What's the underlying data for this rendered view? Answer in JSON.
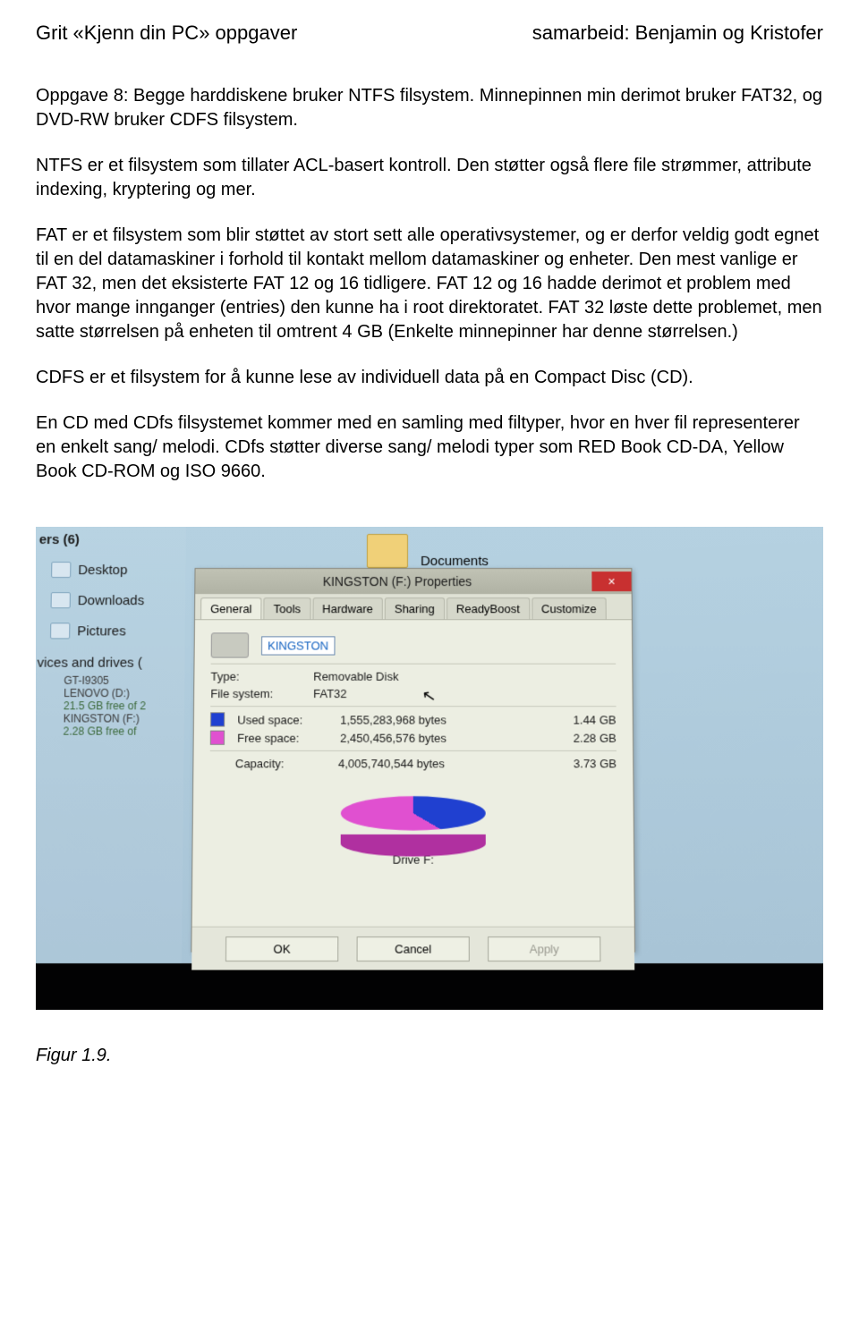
{
  "header": {
    "left": "Grit «Kjenn din PC» oppgaver",
    "right": "samarbeid: Benjamin og Kristofer"
  },
  "paragraphs": {
    "p1": "Oppgave 8: Begge harddiskene bruker NTFS filsystem. Minnepinnen min derimot bruker FAT32, og DVD-RW bruker CDFS filsystem.",
    "p2": "NTFS er et filsystem som tillater ACL-basert kontroll. Den støtter også flere file strømmer, attribute indexing, kryptering og mer.",
    "p3": "FAT er et filsystem som blir støttet av stort sett alle operativsystemer, og er derfor veldig godt egnet til en del datamaskiner i forhold til kontakt mellom datamaskiner og enheter. Den mest vanlige er FAT 32, men det eksisterte FAT 12 og 16 tidligere. FAT 12 og 16 hadde derimot et problem med hvor mange innganger (entries) den kunne ha i root direktoratet. FAT 32 løste dette problemet, men satte størrelsen på enheten til omtrent 4 GB (Enkelte minnepinner har denne størrelsen.)",
    "p4": "CDFS er et filsystem for å kunne lese av individuell data på en Compact Disc (CD).",
    "p5": "En CD med CDfs filsystemet kommer med en samling med filtyper, hvor en hver fil representerer en enkelt sang/ melodi. CDfs støtter diverse sang/ melodi typer som RED Book CD-DA, Yellow Book CD-ROM og ISO 9660."
  },
  "caption": "Figur 1.9.",
  "explorer": {
    "folders_header": "ers (6)",
    "items": {
      "desktop": "Desktop",
      "downloads": "Downloads",
      "pictures": "Pictures"
    },
    "devices_header": "vices and drives (",
    "drives": {
      "gt": "GT-I9305",
      "lenovo": "LENOVO (D:)",
      "lenovo_free": "21.5 GB free of 2",
      "kingston": "KINGSTON (F:)",
      "kingston_free": "2.28 GB free of"
    },
    "documents_label": "Documents"
  },
  "dialog": {
    "title": "KINGSTON (F:) Properties",
    "close": "×",
    "tabs": {
      "general": "General",
      "tools": "Tools",
      "hardware": "Hardware",
      "sharing": "Sharing",
      "readyboost": "ReadyBoost",
      "customize": "Customize"
    },
    "name_value": "KINGSTON",
    "type_label": "Type:",
    "type_value": "Removable Disk",
    "fs_label": "File system:",
    "fs_value": "FAT32",
    "used_label": "Used space:",
    "used_bytes": "1,555,283,968 bytes",
    "used_gb": "1.44 GB",
    "free_label": "Free space:",
    "free_bytes": "2,450,456,576 bytes",
    "free_gb": "2.28 GB",
    "capacity_label": "Capacity:",
    "capacity_bytes": "4,005,740,544 bytes",
    "capacity_gb": "3.73 GB",
    "drive_caption": "Drive F:",
    "buttons": {
      "ok": "OK",
      "cancel": "Cancel",
      "apply": "Apply"
    }
  }
}
